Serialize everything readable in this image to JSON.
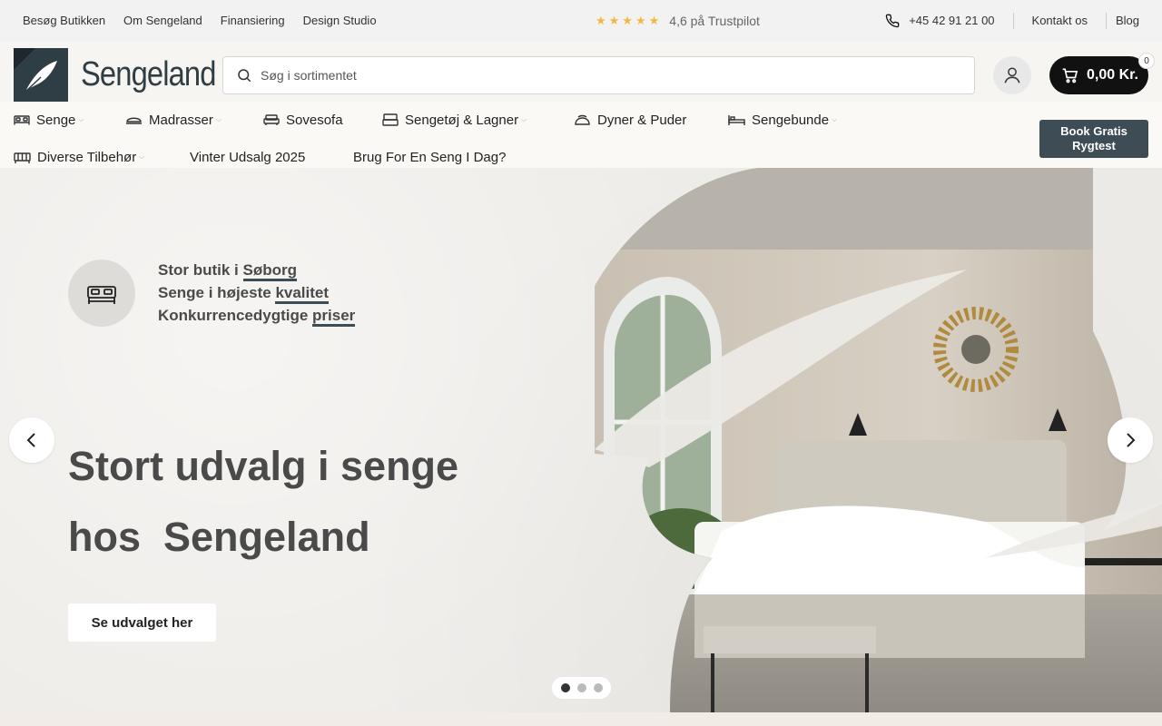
{
  "topbar": {
    "links": [
      "Besøg Butikken",
      "Om Sengeland",
      "Finansiering",
      "Design Studio"
    ],
    "rating": "4,6 på Trustpilot",
    "stars": "★★★★★",
    "phone": "+45 42 91 21 00",
    "contact": "Kontakt os",
    "blog": "Blog"
  },
  "header": {
    "logo_text": "Sengeland",
    "search_placeholder": "Søg i sortimentet",
    "cart_amount": "0,00 Kr.",
    "cart_count": "0"
  },
  "nav": {
    "items": [
      {
        "label": "Senge",
        "icon": "bed-icon",
        "dropdown": true
      },
      {
        "label": "Madrasser",
        "icon": "mattress-icon",
        "dropdown": true
      },
      {
        "label": "Sovesofa",
        "icon": "sofa-icon",
        "dropdown": false
      },
      {
        "label": "Sengetøj & Lagner",
        "icon": "bedding-icon",
        "dropdown": true
      },
      {
        "label": "Dyner & Puder",
        "icon": "duvet-icon",
        "dropdown": false
      },
      {
        "label": "Sengebunde",
        "icon": "bed-frame-icon",
        "dropdown": true
      },
      {
        "label": "Diverse Tilbehør",
        "icon": "accessories-icon",
        "dropdown": true
      },
      {
        "label": "Vinter Udsalg 2025",
        "icon": "",
        "dropdown": false
      },
      {
        "label": "Brug For En Seng I Dag?",
        "icon": "",
        "dropdown": false
      }
    ],
    "book_button": "Book Gratis Rygtest"
  },
  "hero": {
    "features": [
      {
        "prefix": "Stor butik i ",
        "highlight": "Søborg"
      },
      {
        "prefix": "Senge i højeste ",
        "highlight": "kvalitet"
      },
      {
        "prefix": "Konkurrencedygtige ",
        "highlight": "priser"
      }
    ],
    "title_line1": "Stort udvalg i senge",
    "title_line2": "hos  Sengeland",
    "cta": "Se udvalget her",
    "slides": 3,
    "active_slide": 1
  },
  "colors": {
    "brand": "#2f3d45",
    "button_dark": "#3d4c55",
    "star": "#f4b740"
  }
}
